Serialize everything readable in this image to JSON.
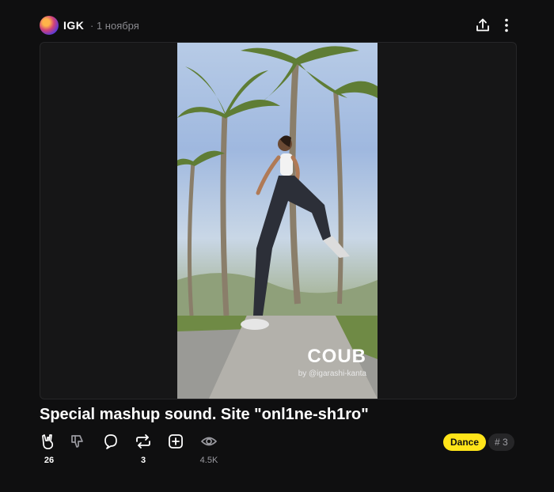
{
  "post": {
    "author": "IGK",
    "date": "· 1 ноября",
    "title": "Special mashup sound. Site \"onl1ne-sh1ro\""
  },
  "header_icons": {
    "share": "share-icon",
    "more": "more-vertical-icon"
  },
  "video": {
    "watermark_logo": "COUB",
    "watermark_by": "by @igarashi-kanta"
  },
  "actions": {
    "like_count": "26",
    "recoub_count": "3",
    "views_count": "4.5K"
  },
  "tags": {
    "dance": "Dance",
    "more": "# 3"
  },
  "colors": {
    "background": "#0f0f10",
    "accent_tag": "#ffe419",
    "muted_text": "#8a8a8f"
  }
}
